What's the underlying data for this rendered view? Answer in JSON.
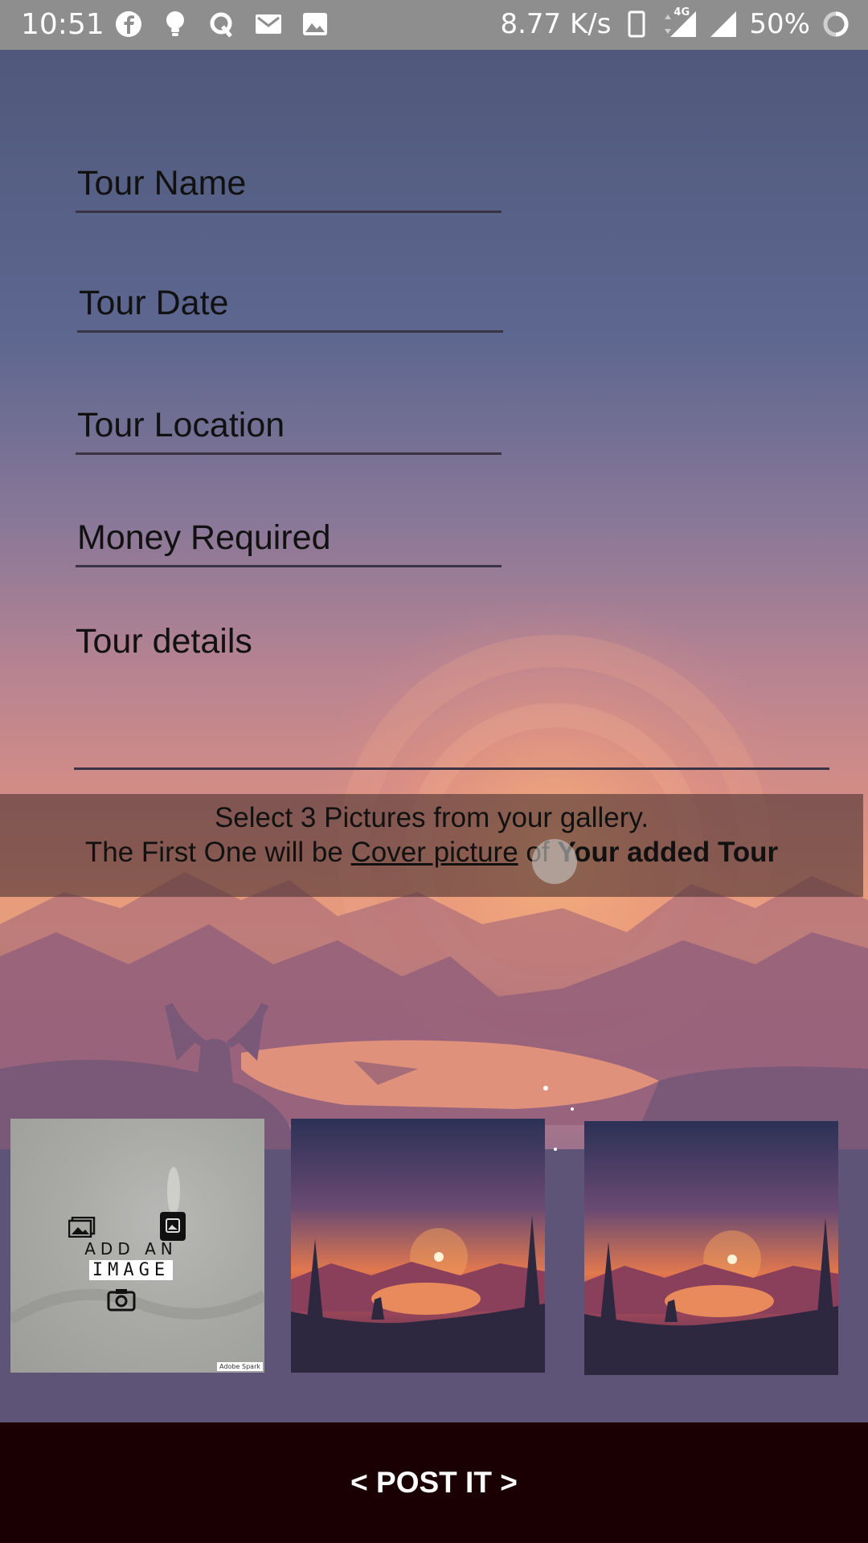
{
  "status_bar": {
    "time": "10:51",
    "net_speed": "8.77 K/s",
    "network_type": "4G",
    "battery": "50%",
    "left_icons": [
      "facebook-icon",
      "bulb-icon",
      "quora-icon",
      "mail-icon",
      "image-icon"
    ],
    "right_icons": [
      "phone-icon",
      "signal-4g-icon",
      "signal-icon",
      "battery-ring-icon"
    ]
  },
  "form": {
    "tour_name_placeholder": "Tour Name",
    "tour_date_placeholder": "Tour Date",
    "tour_location_placeholder": "Tour Location",
    "money_placeholder": "Money Required",
    "details_placeholder": "Tour details"
  },
  "notice": {
    "line1": "Select 3 Pictures from your gallery.",
    "line2_prefix": "The First One will be ",
    "line2_link": "Cover picture",
    "line2_mid": " of ",
    "line2_bold": "Your added Tour"
  },
  "pictures": {
    "add_line1": "ADD AN",
    "add_line2": "IMAGE",
    "credit": "Adobe Spark"
  },
  "post_button": "< POST IT >",
  "colors": {
    "status_bar": "#8e8e8e",
    "post_bar": "#1a0002",
    "field_line": "#3a3346"
  }
}
